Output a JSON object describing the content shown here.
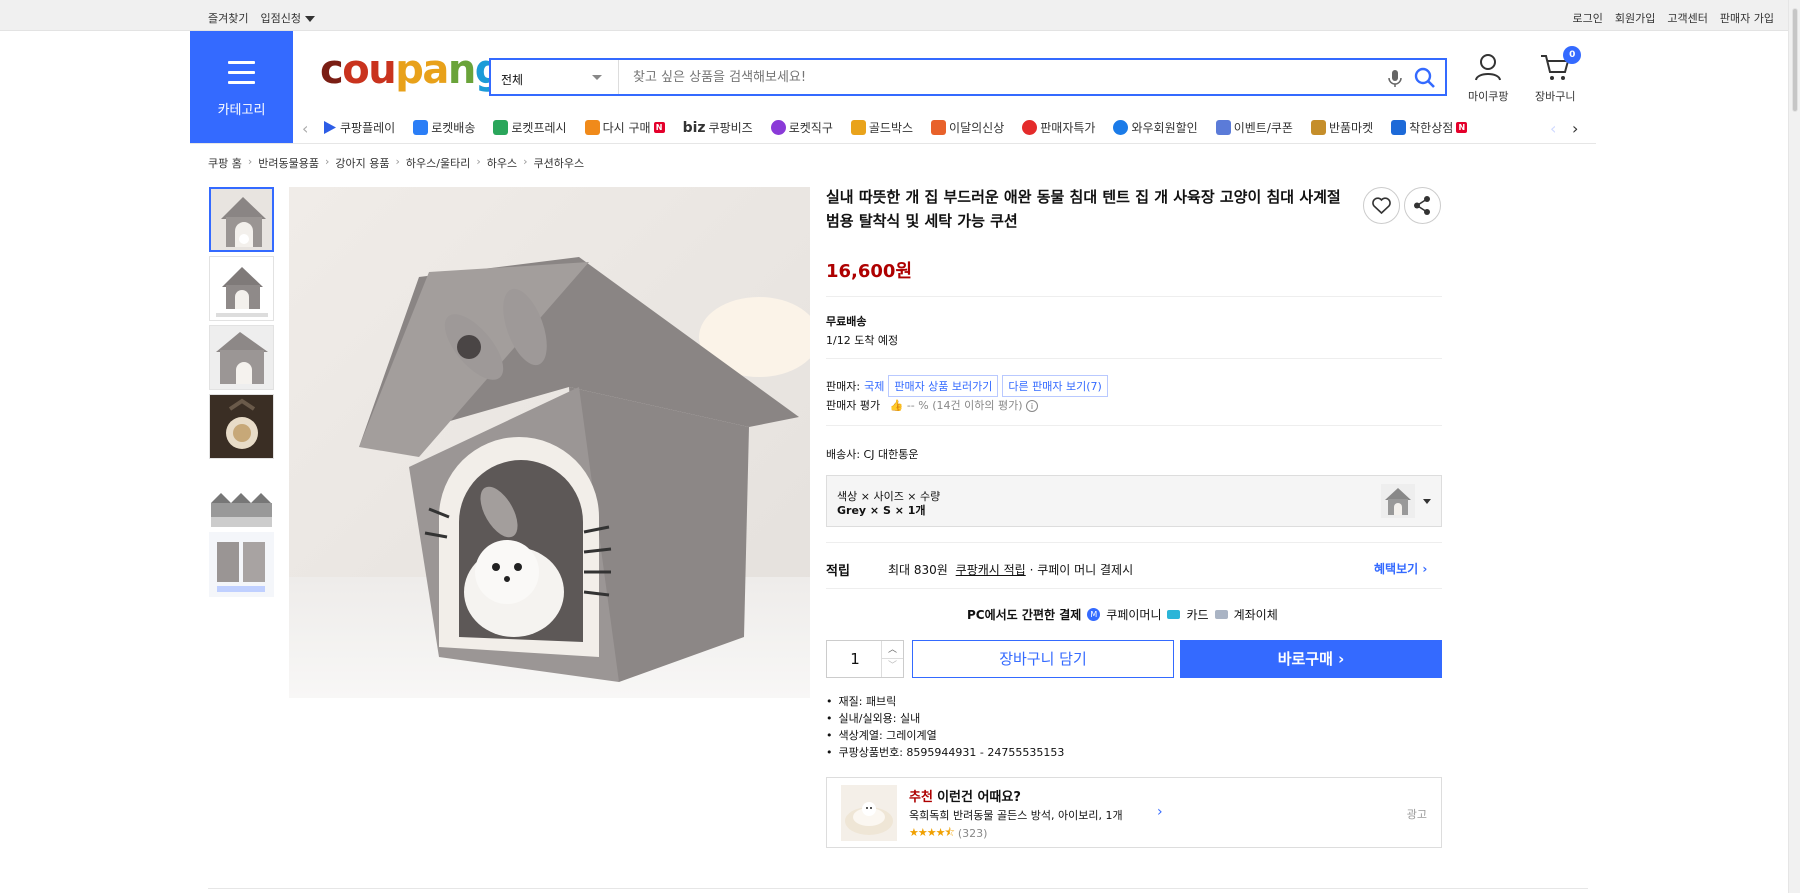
{
  "topbar": {
    "left": [
      "즐겨찾기",
      "입점신청"
    ],
    "right": [
      "로그인",
      "회원가입",
      "고객센터",
      "판매자 가입"
    ]
  },
  "header": {
    "category_label": "카테고리",
    "logo_text": "coupang",
    "search_category": "전체",
    "search_placeholder": "찾고 싶은 상품을 검색해보세요!",
    "mypage_label": "마이쿠팡",
    "cart_label": "장바구니",
    "cart_count": "0"
  },
  "nav": {
    "items": [
      {
        "label": "쿠팡플레이",
        "color": "#2d5de6"
      },
      {
        "label": "로켓배송",
        "color": "#2b7ef6"
      },
      {
        "label": "로켓프레시",
        "color": "#2aa65b"
      },
      {
        "label": "다시 구매",
        "color": "#f08a1a"
      },
      {
        "label": "쿠팡비즈",
        "prefix": "biz",
        "color": "#111"
      },
      {
        "label": "로켓직구",
        "color": "#8a3ad8"
      },
      {
        "label": "골드박스",
        "color": "#e9a31b"
      },
      {
        "label": "이달의신상",
        "color": "#e8612a"
      },
      {
        "label": "판매자특가",
        "color": "#e42b2b"
      },
      {
        "label": "와우회원할인",
        "color": "#1b7be8"
      },
      {
        "label": "이벤트/쿠폰",
        "color": "#5b7bd8"
      },
      {
        "label": "반품마켓",
        "color": "#c58e2a"
      },
      {
        "label": "착한상점",
        "color": "#1d6ad8"
      }
    ]
  },
  "breadcrumb": [
    "쿠팡 홈",
    "반려동물용품",
    "강아지 용품",
    "하우스/울타리",
    "하우스",
    "쿠션하우스"
  ],
  "product": {
    "title": "실내 따뜻한 개 집 부드러운 애완 동물 침대 텐트 집 개 사육장 고양이 침대 사계절 범용 탈착식 및 세탁 가능 쿠션",
    "price": "16,600원",
    "shipping_label": "무료배송",
    "arrival": "1/12 도착 예정",
    "seller_prefix": "판매자:",
    "seller_name": "국제",
    "seller_goods_btn": "판매자 상품 보러가기",
    "other_sellers_btn": "다른 판매자 보기(7)",
    "seller_rating_label": "판매자 평가",
    "seller_rating_value": "-- % (14건 이하의 평가)",
    "carrier": "배송사:  CJ 대한통운",
    "option_header": "색상 × 사이즈 × 수량",
    "option_value": "Grey × S × 1개",
    "reward_label": "적립",
    "reward_text": "최대 830원",
    "reward_link": "쿠팡캐시 적립",
    "reward_suffix": "· 쿠페이 머니 결제시",
    "benefit_link": "혜택보기",
    "pay_title": "PC에서도 간편한 결제",
    "pay_options": [
      "쿠페이머니",
      "카드",
      "계좌이체"
    ],
    "quantity": "1",
    "cart_button": "장바구니 담기",
    "buy_button": "바로구매",
    "specs": [
      "재질: 패브릭",
      "실내/실외용: 실내",
      "색상계열: 그레이계열",
      "쿠팡상품번호: 8595944931 - 24755535153"
    ]
  },
  "recommend": {
    "tag": "추천",
    "title": "이런건 어때요?",
    "item": "옥희독희 반려동물 골든스 방석, 아이보리, 1개",
    "rating": 4.5,
    "reviews": "(323)",
    "ad_label": "광고"
  },
  "colors": {
    "accent": "#346aff",
    "price": "#ae0000"
  }
}
